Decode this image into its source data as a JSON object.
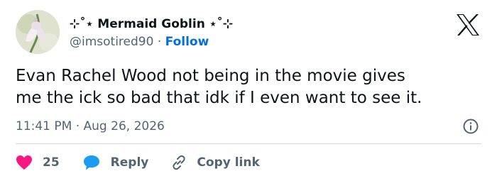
{
  "tweet": {
    "author": {
      "display_name": "⊹˚⋆ Mermaid Goblin ⋆˚⊹",
      "handle": "@imsotired90",
      "separator": "·",
      "follow_label": "Follow"
    },
    "text_lines": [
      "Evan Rachel Wood not being in the movie gives",
      "me the ick so bad that idk if I even want to see it."
    ],
    "time": "11:41 PM",
    "date": "Aug 26, 2026",
    "timestamp": "11:41 PM · Aug 26, 2026"
  },
  "actions": {
    "like_count": "25",
    "reply_label": "Reply",
    "copy_link_label": "Copy link"
  },
  "colors": {
    "like": "#f91880",
    "reply": "#1d9bf0",
    "follow": "#006fd6",
    "muted": "#536471",
    "text": "#0f1419"
  },
  "icons": {
    "logo": "x-logo-icon",
    "info": "info-icon",
    "like": "heart-icon",
    "reply": "speech-bubble-icon",
    "copy": "link-icon"
  }
}
